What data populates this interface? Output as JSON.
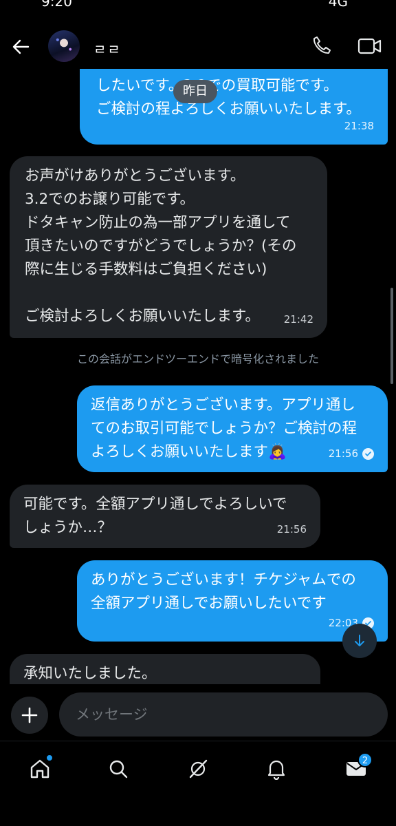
{
  "status_bar": {
    "time": "9:20",
    "system": "4G"
  },
  "header": {
    "contact_name": "ㄹㄹ"
  },
  "chat": {
    "date_divider": "昨日",
    "encryption_note": "この会話がエンドツーエンドで暗号化されました",
    "messages": [
      {
        "direction": "out",
        "text": "したいです。3.2での買取可能です。\nご検討の程よろしくお願いいたします。",
        "time": "21:38",
        "read": false
      },
      {
        "direction": "in",
        "text": "お声がけありがとうございます。\n3.2でのお譲り可能です。\nドタキャン防止の為一部アプリを通して\n頂きたいのですがどうでしょうか？(その\n際に生じる手数料はご負担ください)\n\nご検討よろしくお願いいたします。",
        "time": "21:42"
      },
      {
        "direction": "out",
        "text": "返信ありがとうございます。アプリ通し\nてのお取引可能でしょうか？ご検討の程\nよろしくお願いいたします🙇‍♀️",
        "time": "21:56",
        "read": true
      },
      {
        "direction": "in",
        "text": "可能です。全額アプリ通しでよろしいで\nしょうか…？",
        "time": "21:56"
      },
      {
        "direction": "out",
        "text": "ありがとうございます！チケジャムでの\n全額アプリ通しでお願いしたいです",
        "time": "22:03",
        "read": true
      },
      {
        "direction": "in",
        "text": "承知いたしました。",
        "time": ""
      }
    ]
  },
  "composer": {
    "placeholder": "メッセージ"
  },
  "bottom_nav": {
    "items": [
      "home-icon",
      "search-icon",
      "grok-icon",
      "notifications-icon",
      "messages-icon"
    ],
    "messages_badge": "2"
  },
  "colors": {
    "outgoing_bubble": "#1d9bf0",
    "incoming_bubble": "#202327",
    "background": "#000000",
    "accent": "#1d9bf0"
  }
}
